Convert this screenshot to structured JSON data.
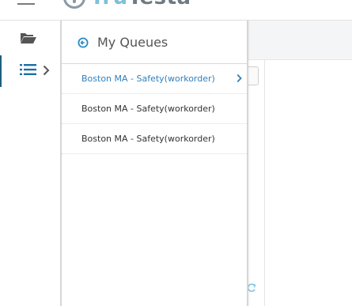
{
  "header": {
    "logo_part1": "Tru",
    "logo_part2": "Testa",
    "menu_icon": "hamburger-icon"
  },
  "rail": {
    "items": [
      {
        "icon": "folder-open-icon"
      },
      {
        "icon": "list-icon",
        "expand_icon": "chevron-right-icon"
      }
    ]
  },
  "queues_panel": {
    "title": "My Queues",
    "back_icon": "arrow-left-circle-icon",
    "items": [
      {
        "label": "Boston MA - Safety(workorder)",
        "active": true
      },
      {
        "label": "Boston MA - Safety(workorder)",
        "active": false
      },
      {
        "label": "Boston MA - Safety(workorder)",
        "active": false
      }
    ]
  },
  "colors": {
    "accent": "#2f7fbd",
    "rail_active_border": "#1f5e7e",
    "icon_blue": "#1e6fa3",
    "refresh_icon": "#7cc4e0"
  }
}
